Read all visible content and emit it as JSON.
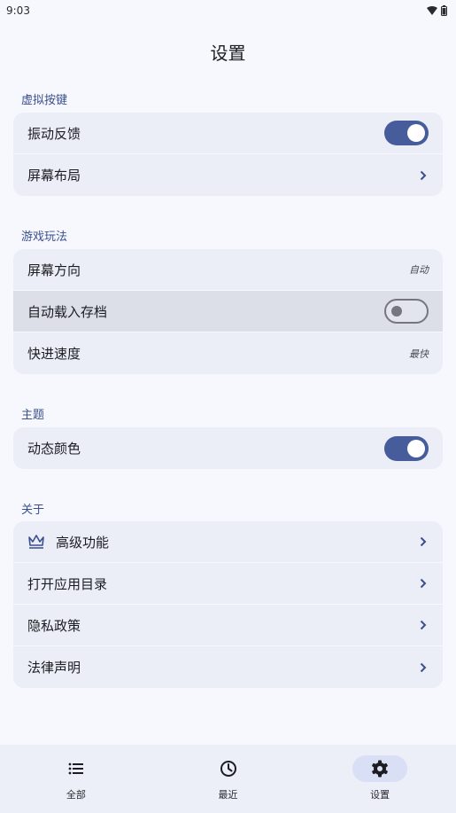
{
  "status_bar": {
    "time": "9:03"
  },
  "page": {
    "title": "设置"
  },
  "sections": {
    "virtual_keys": {
      "header": "虚拟按键",
      "vibration_label": "振动反馈",
      "vibration_on": true,
      "layout_label": "屏幕布局"
    },
    "gameplay": {
      "header": "游戏玩法",
      "orientation_label": "屏幕方向",
      "orientation_value": "自动",
      "autoload_label": "自动载入存档",
      "autoload_on": false,
      "speed_label": "快进速度",
      "speed_value": "最快"
    },
    "theme": {
      "header": "主题",
      "dynamic_color_label": "动态颜色",
      "dynamic_color_on": true
    },
    "about": {
      "header": "关于",
      "premium_label": "高级功能",
      "open_dir_label": "打开应用目录",
      "privacy_label": "隐私政策",
      "legal_label": "法律声明"
    }
  },
  "bottom_nav": {
    "items": [
      {
        "label": "全部",
        "icon": "list-icon",
        "active": false
      },
      {
        "label": "最近",
        "icon": "clock-icon",
        "active": false
      },
      {
        "label": "设置",
        "icon": "gear-icon",
        "active": true
      }
    ]
  },
  "colors": {
    "accent": "#465c9b",
    "section_header": "#3b4f8e",
    "card": "#ebeef7",
    "background": "#f7f8fd"
  }
}
